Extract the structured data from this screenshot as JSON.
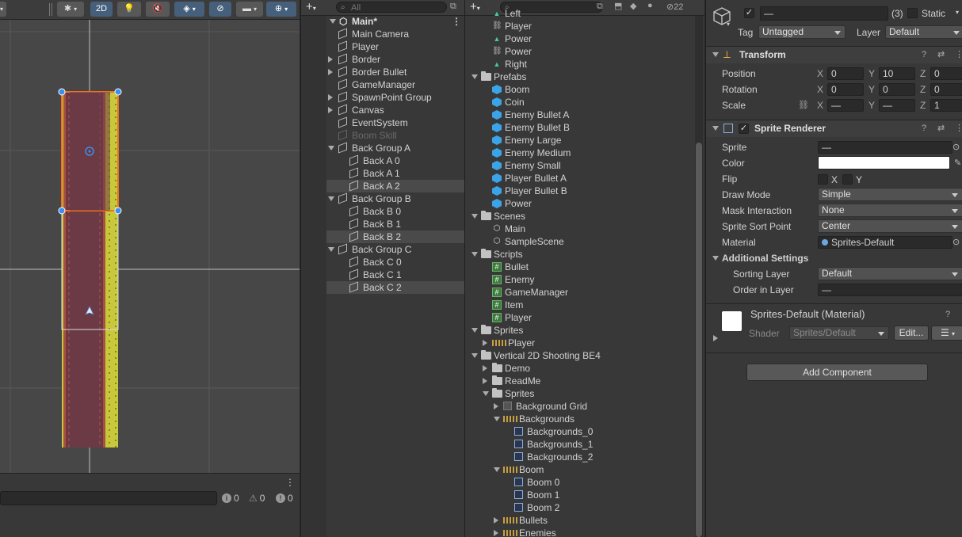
{
  "scene": {
    "toolbar": {
      "mode_2d": "2D"
    },
    "console": {
      "log_count": "0",
      "warning_count": "0",
      "error_count": "0"
    }
  },
  "hierarchy": {
    "search_placeholder": "All",
    "scene_name": "Main*",
    "items": [
      {
        "label": "Main Camera",
        "depth": 1,
        "foldout": "none",
        "selected": false,
        "dim": false
      },
      {
        "label": "Player",
        "depth": 1,
        "foldout": "none",
        "selected": false,
        "dim": false
      },
      {
        "label": "Border",
        "depth": 1,
        "foldout": "closed",
        "selected": false,
        "dim": false
      },
      {
        "label": "Border Bullet",
        "depth": 1,
        "foldout": "closed",
        "selected": false,
        "dim": false
      },
      {
        "label": "GameManager",
        "depth": 1,
        "foldout": "none",
        "selected": false,
        "dim": false
      },
      {
        "label": "SpawnPoint Group",
        "depth": 1,
        "foldout": "closed",
        "selected": false,
        "dim": false
      },
      {
        "label": "Canvas",
        "depth": 1,
        "foldout": "closed",
        "selected": false,
        "dim": false
      },
      {
        "label": "EventSystem",
        "depth": 1,
        "foldout": "none",
        "selected": false,
        "dim": false
      },
      {
        "label": "Boom Skill",
        "depth": 1,
        "foldout": "none",
        "selected": false,
        "dim": true
      },
      {
        "label": "Back Group A",
        "depth": 1,
        "foldout": "open",
        "selected": false,
        "dim": false
      },
      {
        "label": "Back A 0",
        "depth": 2,
        "foldout": "none",
        "selected": false,
        "dim": false
      },
      {
        "label": "Back A 1",
        "depth": 2,
        "foldout": "none",
        "selected": false,
        "dim": false
      },
      {
        "label": "Back A 2",
        "depth": 2,
        "foldout": "none",
        "selected": true,
        "dim": false
      },
      {
        "label": "Back Group B",
        "depth": 1,
        "foldout": "open",
        "selected": false,
        "dim": false
      },
      {
        "label": "Back B 0",
        "depth": 2,
        "foldout": "none",
        "selected": false,
        "dim": false
      },
      {
        "label": "Back B 1",
        "depth": 2,
        "foldout": "none",
        "selected": false,
        "dim": false
      },
      {
        "label": "Back B 2",
        "depth": 2,
        "foldout": "none",
        "selected": true,
        "dim": false
      },
      {
        "label": "Back Group C",
        "depth": 1,
        "foldout": "open",
        "selected": false,
        "dim": false
      },
      {
        "label": "Back C 0",
        "depth": 2,
        "foldout": "none",
        "selected": false,
        "dim": false
      },
      {
        "label": "Back C 1",
        "depth": 2,
        "foldout": "none",
        "selected": false,
        "dim": false
      },
      {
        "label": "Back C 2",
        "depth": 2,
        "foldout": "none",
        "selected": true,
        "dim": false
      }
    ]
  },
  "project": {
    "hidden_count": "22",
    "items": [
      {
        "label": "Left",
        "depth": 1,
        "icon": "power-icon",
        "foldout": "none"
      },
      {
        "label": "Player",
        "depth": 1,
        "icon": "animator-icon",
        "foldout": "none"
      },
      {
        "label": "Power",
        "depth": 1,
        "icon": "power-icon",
        "foldout": "none"
      },
      {
        "label": "Power",
        "depth": 1,
        "icon": "animator-icon",
        "foldout": "none"
      },
      {
        "label": "Right",
        "depth": 1,
        "icon": "power-icon",
        "foldout": "none"
      },
      {
        "label": "Prefabs",
        "depth": 0,
        "icon": "folder-icon",
        "foldout": "open"
      },
      {
        "label": "Boom",
        "depth": 1,
        "icon": "prefab-icon",
        "foldout": "none"
      },
      {
        "label": "Coin",
        "depth": 1,
        "icon": "prefab-icon",
        "foldout": "none"
      },
      {
        "label": "Enemy Bullet A",
        "depth": 1,
        "icon": "prefab-icon",
        "foldout": "none"
      },
      {
        "label": "Enemy Bullet B",
        "depth": 1,
        "icon": "prefab-icon",
        "foldout": "none"
      },
      {
        "label": "Enemy Large",
        "depth": 1,
        "icon": "prefab-icon",
        "foldout": "none"
      },
      {
        "label": "Enemy Medium",
        "depth": 1,
        "icon": "prefab-icon",
        "foldout": "none"
      },
      {
        "label": "Enemy Small",
        "depth": 1,
        "icon": "prefab-icon",
        "foldout": "none"
      },
      {
        "label": "Player Bullet A",
        "depth": 1,
        "icon": "prefab-icon",
        "foldout": "none"
      },
      {
        "label": "Player Bullet B",
        "depth": 1,
        "icon": "prefab-icon",
        "foldout": "none"
      },
      {
        "label": "Power",
        "depth": 1,
        "icon": "prefab-icon",
        "foldout": "none"
      },
      {
        "label": "Scenes",
        "depth": 0,
        "icon": "folder-icon",
        "foldout": "open"
      },
      {
        "label": "Main",
        "depth": 1,
        "icon": "scene-icon",
        "foldout": "none"
      },
      {
        "label": "SampleScene",
        "depth": 1,
        "icon": "scene-icon",
        "foldout": "none"
      },
      {
        "label": "Scripts",
        "depth": 0,
        "icon": "folder-icon",
        "foldout": "open"
      },
      {
        "label": "Bullet",
        "depth": 1,
        "icon": "script-icon",
        "foldout": "none"
      },
      {
        "label": "Enemy",
        "depth": 1,
        "icon": "script-icon",
        "foldout": "none"
      },
      {
        "label": "GameManager",
        "depth": 1,
        "icon": "script-icon",
        "foldout": "none"
      },
      {
        "label": "Item",
        "depth": 1,
        "icon": "script-icon",
        "foldout": "none"
      },
      {
        "label": "Player",
        "depth": 1,
        "icon": "script-icon",
        "foldout": "none"
      },
      {
        "label": "Sprites",
        "depth": 0,
        "icon": "folder-icon",
        "foldout": "open"
      },
      {
        "label": "Player",
        "depth": 1,
        "icon": "spritesheet-icon",
        "foldout": "closed"
      },
      {
        "label": "Vertical 2D Shooting BE4",
        "depth": 0,
        "icon": "folder-icon",
        "foldout": "open"
      },
      {
        "label": "Demo",
        "depth": 1,
        "icon": "folder-icon",
        "foldout": "closed"
      },
      {
        "label": "ReadMe",
        "depth": 1,
        "icon": "folder-icon",
        "foldout": "closed"
      },
      {
        "label": "Sprites",
        "depth": 1,
        "icon": "folder-icon",
        "foldout": "open"
      },
      {
        "label": "Background Grid",
        "depth": 2,
        "icon": "texture-icon",
        "foldout": "closed"
      },
      {
        "label": "Backgrounds",
        "depth": 2,
        "icon": "spritesheet-icon",
        "foldout": "open"
      },
      {
        "label": "Backgrounds_0",
        "depth": 3,
        "icon": "sprite-icon",
        "foldout": "none"
      },
      {
        "label": "Backgrounds_1",
        "depth": 3,
        "icon": "sprite-icon",
        "foldout": "none"
      },
      {
        "label": "Backgrounds_2",
        "depth": 3,
        "icon": "sprite-icon",
        "foldout": "none"
      },
      {
        "label": "Boom",
        "depth": 2,
        "icon": "spritesheet-icon",
        "foldout": "open"
      },
      {
        "label": "Boom 0",
        "depth": 3,
        "icon": "sprite-icon",
        "foldout": "none"
      },
      {
        "label": "Boom 1",
        "depth": 3,
        "icon": "sprite-icon",
        "foldout": "none"
      },
      {
        "label": "Boom 2",
        "depth": 3,
        "icon": "sprite-icon",
        "foldout": "none"
      },
      {
        "label": "Bullets",
        "depth": 2,
        "icon": "spritesheet-icon",
        "foldout": "closed"
      },
      {
        "label": "Enemies",
        "depth": 2,
        "icon": "spritesheet-icon",
        "foldout": "closed"
      }
    ]
  },
  "inspector": {
    "object_name": "—",
    "object_count": "(3)",
    "static_label": "Static",
    "tag_label": "Tag",
    "tag_value": "Untagged",
    "layer_label": "Layer",
    "layer_value": "Default",
    "transform": {
      "title": "Transform",
      "position_label": "Position",
      "rotation_label": "Rotation",
      "scale_label": "Scale",
      "x_label": "X",
      "y_label": "Y",
      "z_label": "Z",
      "position": {
        "x": "0",
        "y": "10",
        "z": "0"
      },
      "rotation": {
        "x": "0",
        "y": "0",
        "z": "0"
      },
      "scale": {
        "x": "—",
        "y": "—",
        "z": "1"
      }
    },
    "sprite_renderer": {
      "title": "Sprite Renderer",
      "sprite_label": "Sprite",
      "sprite_value": "—",
      "color_label": "Color",
      "color_value": "#ffffff",
      "flip_label": "Flip",
      "flip_x": "X",
      "flip_y": "Y",
      "draw_mode_label": "Draw Mode",
      "draw_mode_value": "Simple",
      "mask_label": "Mask Interaction",
      "mask_value": "None",
      "sort_point_label": "Sprite Sort Point",
      "sort_point_value": "Center",
      "material_label": "Material",
      "material_value": "Sprites-Default",
      "additional_label": "Additional Settings",
      "sorting_layer_label": "Sorting Layer",
      "sorting_layer_value": "Default",
      "order_label": "Order in Layer",
      "order_value": "—"
    },
    "material": {
      "title": "Sprites-Default (Material)",
      "shader_label": "Shader",
      "shader_value": "Sprites/Default",
      "edit_label": "Edit..."
    },
    "add_component_label": "Add Component"
  },
  "colors": {
    "accent_blue": "#46607c",
    "selection_orange": "#f07020",
    "prefab_blue": "#3ba4e8"
  }
}
